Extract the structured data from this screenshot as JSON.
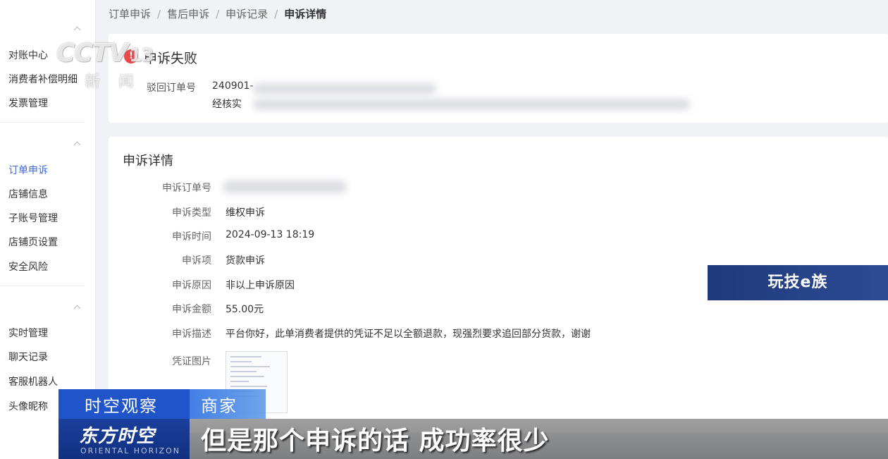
{
  "sidebar": {
    "group1": [
      "对账中心",
      "消费者补偿明细",
      "发票管理"
    ],
    "group2": [
      "订单申诉",
      "店铺信息",
      "子账号管理",
      "店铺页设置",
      "安全风险"
    ],
    "group3": [
      "实时管理",
      "聊天记录",
      "客服机器人",
      "头像昵称"
    ],
    "active": "订单申诉"
  },
  "breadcrumb": [
    "订单申诉",
    "售后申诉",
    "申诉记录",
    "申诉详情"
  ],
  "breadcrumb_sep": "/",
  "result": {
    "icon": "!",
    "title": "申诉失败",
    "reject_label": "驳回订单号",
    "reject_value_line1": "240901-",
    "reject_value_line2": "经核实"
  },
  "detail": {
    "title": "申诉详情",
    "rows": [
      {
        "label": "申诉订单号",
        "value": ""
      },
      {
        "label": "申诉类型",
        "value": "维权申诉"
      },
      {
        "label": "申诉时间",
        "value": "2024-09-13 18:19"
      },
      {
        "label": "申诉项",
        "value": "货款申诉"
      },
      {
        "label": "申诉原因",
        "value": "非以上申诉原因"
      },
      {
        "label": "申诉金额",
        "value": "55.00元"
      },
      {
        "label": "申诉描述",
        "value": "平台你好，此单消费者提供的凭证不足以全额退款，现强烈要求追回部分货款，谢谢"
      },
      {
        "label": "凭证图片",
        "value": ""
      }
    ]
  },
  "overlay": {
    "cctv_logo": "CCTV",
    "cctv_channel": "13",
    "cctv_news_1": "新",
    "cctv_news_2": "闻",
    "program_badge": "玩技e族",
    "lower_third_section": "时空观察",
    "lower_third_speaker": "商家",
    "show_name": "东方时空",
    "show_name_en": "ORIENTAL HORIZON",
    "subtitle": "但是那个申诉的话 成功率很少"
  },
  "colors": {
    "accent": "#3f6ad8",
    "fail": "#e94949",
    "lower_third_blue": "#1f55c9"
  }
}
